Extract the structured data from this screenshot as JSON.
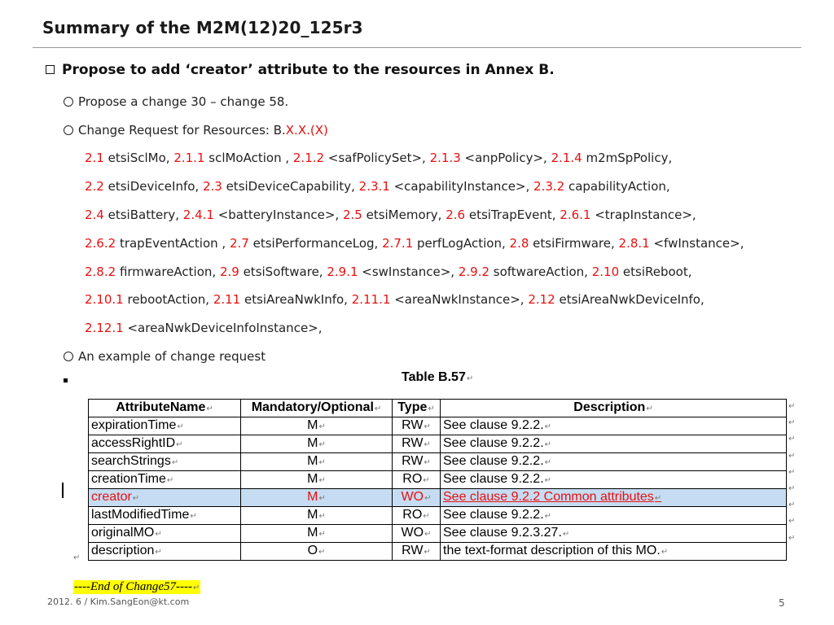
{
  "slide": {
    "title": "Summary of the M2M(12)20_125r3",
    "main_bullet": "Propose to add ‘creator’ attribute to the resources in Annex B.",
    "sub1": "Propose a change 30 – change 58.",
    "sub2_prefix": "Change Request for Resources: B.",
    "sub2_red": "X.X.(X)",
    "resource_lines": [
      [
        [
          "2.1",
          " etsiSclMo, "
        ],
        [
          "2.1.1",
          " sclMoAction , "
        ],
        [
          "2.1.2",
          " <safPolicySet>, "
        ],
        [
          "2.1.3",
          " <anpPolicy>, "
        ],
        [
          "2.1.4",
          " m2mSpPolicy,"
        ]
      ],
      [
        [
          "2.2",
          " etsiDeviceInfo, "
        ],
        [
          "2.3",
          " etsiDeviceCapability, "
        ],
        [
          "2.3.1",
          " <capabilityInstance>, "
        ],
        [
          "2.3.2",
          " capabilityAction,"
        ]
      ],
      [
        [
          "2.4",
          " etsiBattery, "
        ],
        [
          "2.4.1",
          " <batteryInstance>, "
        ],
        [
          "2.5",
          " etsiMemory, "
        ],
        [
          "2.6",
          " etsiTrapEvent, "
        ],
        [
          "2.6.1",
          " <trapInstance>,"
        ]
      ],
      [
        [
          "2.6.2",
          " trapEventAction , "
        ],
        [
          "2.7",
          " etsiPerformanceLog, "
        ],
        [
          "2.7.1",
          " perfLogAction, "
        ],
        [
          "2.8",
          " etsiFirmware, "
        ],
        [
          "2.8.1",
          " <fwInstance>,"
        ]
      ],
      [
        [
          "2.8.2",
          " firmwareAction, "
        ],
        [
          "2.9",
          " etsiSoftware, "
        ],
        [
          "2.9.1",
          " <swInstance>, "
        ],
        [
          "2.9.2",
          " softwareAction, "
        ],
        [
          "2.10",
          " etsiReboot,"
        ]
      ],
      [
        [
          "2.10.1",
          " rebootAction, "
        ],
        [
          "2.11",
          " etsiAreaNwkInfo, "
        ],
        [
          "2.11.1",
          " <areaNwkInstance>, "
        ],
        [
          "2.12",
          " etsiAreaNwkDeviceInfo,"
        ]
      ],
      [
        [
          "2.12.1",
          " <areaNwkDeviceInfoInstance>,"
        ]
      ]
    ],
    "sub3": "An example of change request"
  },
  "table": {
    "caption": "Table B.57",
    "headers": [
      "AttributeName",
      "Mandatory/Optional",
      "Type",
      "Description"
    ],
    "rows": [
      [
        "expirationTime",
        "M",
        "RW",
        "See clause 9.2.2."
      ],
      [
        "accessRightID",
        "M",
        "RW",
        "See clause 9.2.2."
      ],
      [
        "searchStrings",
        "M",
        "RW",
        "See clause 9.2.2."
      ],
      [
        "creationTime",
        "M",
        "RO",
        "See clause 9.2.2."
      ],
      [
        "creator",
        "M",
        "WO",
        "See clause 9.2.2 Common attributes"
      ],
      [
        "lastModifiedTime",
        "M",
        "RO",
        "See clause 9.2.2."
      ],
      [
        "originalMO",
        "M",
        "WO",
        "See clause 9.2.3.27."
      ],
      [
        "description",
        "O",
        "RW",
        "the text-format description of this MO."
      ]
    ],
    "highlight_row": 4,
    "highlight_color": "#c6dcf2",
    "red_color": "#e81010"
  },
  "end_marker": {
    "dashes_left": "----",
    "text": "End of Change57",
    "dashes_right": "----"
  },
  "footer": {
    "left": "2012. 6 / Kim.SangEon@kt.com",
    "page": "5"
  }
}
